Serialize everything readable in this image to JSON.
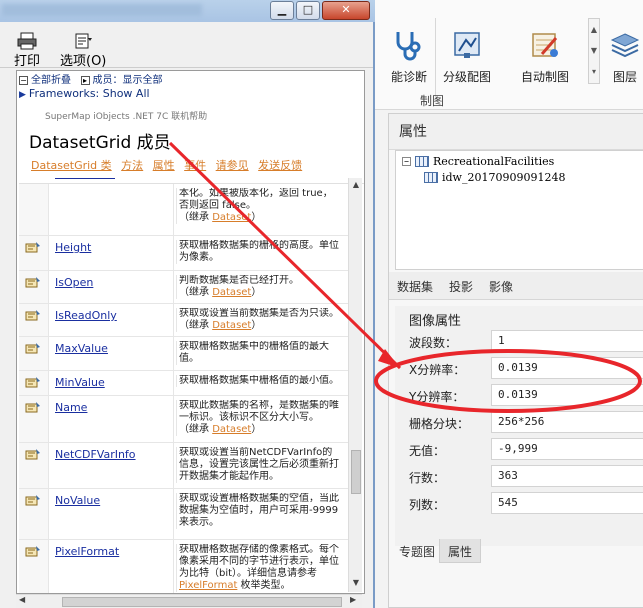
{
  "help_window": {
    "toolbar": {
      "print_label": "打印",
      "options_label": "选项(O)"
    },
    "toc": {
      "collapse_all": "全部折叠",
      "members_filter": "成员：显示全部"
    },
    "frameworks_link": "Frameworks: Show All",
    "breadcrumb": "SuperMap iObjects .NET 7C 联机帮助",
    "page_title": "DatasetGrid 成员",
    "links": [
      "DatasetGrid 类",
      "方法",
      "属性",
      "事件",
      "请参见",
      "发送反馈"
    ],
    "members": [
      {
        "name": "",
        "desc": "本化。如果被版本化，返回 true，\n否则返回 false。\n（继承 ",
        "link": "Dataset",
        "tail": "）"
      },
      {
        "name": "Height",
        "desc": "获取栅格数据集的栅格的高度。单位\n为像素。",
        "link": "",
        "tail": ""
      },
      {
        "name": "IsOpen",
        "desc": "判断数据集是否已经打开。\n（继承 ",
        "link": "Dataset",
        "tail": "）"
      },
      {
        "name": "IsReadOnly",
        "desc": "获取或设置当前数据集是否为只读。\n（继承 ",
        "link": "Dataset",
        "tail": "）"
      },
      {
        "name": "MaxValue",
        "desc": "获取栅格数据集中的栅格值的最大\n值。",
        "link": "",
        "tail": ""
      },
      {
        "name": "MinValue",
        "desc": "获取栅格数据集中栅格值的最小值。",
        "link": "",
        "tail": ""
      },
      {
        "name": "Name",
        "desc": "获取此数据集的名称，是数据集的唯\n一标识。该标识不区分大小写。\n（继承 ",
        "link": "Dataset",
        "tail": "）"
      },
      {
        "name": "NetCDFVarInfo",
        "desc": "获取或设置当前NetCDFVarInfo的\n信息，设置完该属性之后必须重新打\n开数据集才能起作用。",
        "link": "",
        "tail": ""
      },
      {
        "name": "NoValue",
        "desc": "获取或设置栅格数据集的空值，当此\n数据集为空值时，用户可采用-9999\n来表示。",
        "link": "",
        "tail": ""
      },
      {
        "name": "PixelFormat",
        "desc": "获取栅格数据存储的像素格式。每个\n像素采用不同的字节进行表示，单位\n为比特（bit）。详细信息请参考\n",
        "link": "PixelFormat",
        "tail": " 枚举类型。"
      }
    ]
  },
  "ribbon": {
    "buttons": [
      "能诊断",
      "分级配图",
      "自动制图",
      "图层"
    ],
    "group_label": "制图"
  },
  "properties_panel": {
    "title": "属性",
    "tree_root": "RecreationalFacilities",
    "tree_child": "idw_20170909091248",
    "tabs": [
      "数据集",
      "投影",
      "影像"
    ],
    "section_title": "图像属性",
    "rows": [
      {
        "label": "波段数：",
        "value": "1"
      },
      {
        "label": "X分辨率：",
        "value": "0.0139"
      },
      {
        "label": "Y分辨率：",
        "value": "0.0139"
      },
      {
        "label": "栅格分块：",
        "value": "256*256"
      },
      {
        "label": "无值：",
        "value": "-9,999"
      },
      {
        "label": "行数：",
        "value": "363"
      },
      {
        "label": "列数：",
        "value": "545"
      }
    ],
    "bottom_tabs": [
      "专题图",
      "属性"
    ]
  },
  "colors": {
    "annotation_red": "#e8262b",
    "link_blue": "#1a2fa0",
    "link_orange": "#d77d2a"
  }
}
